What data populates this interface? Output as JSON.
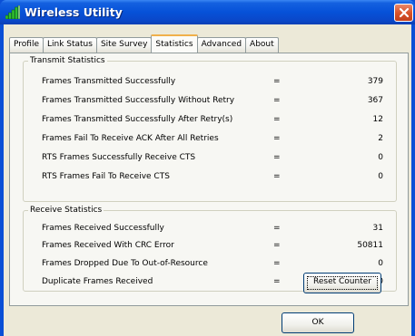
{
  "window": {
    "title": "Wireless Utility",
    "icon": "signal-bars-icon",
    "close_icon": "close-icon",
    "accent_color": "#0a4fd6",
    "close_color": "#d9542b"
  },
  "tabs": [
    {
      "label": "Profile",
      "active": false
    },
    {
      "label": "Link Status",
      "active": false
    },
    {
      "label": "Site Survey",
      "active": false
    },
    {
      "label": "Statistics",
      "active": true
    },
    {
      "label": "Advanced",
      "active": false
    },
    {
      "label": "About",
      "active": false
    }
  ],
  "transmit": {
    "title": "Transmit Statistics",
    "rows": [
      {
        "label": "Frames Transmitted Successfully",
        "eq": "=",
        "value": "379"
      },
      {
        "label": "Frames Transmitted Successfully  Without Retry",
        "eq": "=",
        "value": "367"
      },
      {
        "label": "Frames Transmitted Successfully After Retry(s)",
        "eq": "=",
        "value": "12"
      },
      {
        "label": "Frames Fail To Receive ACK After All Retries",
        "eq": "=",
        "value": "2"
      },
      {
        "label": "RTS Frames Successfully Receive CTS",
        "eq": "=",
        "value": "0"
      },
      {
        "label": "RTS Frames Fail To Receive CTS",
        "eq": "=",
        "value": "0"
      }
    ]
  },
  "receive": {
    "title": "Receive Statistics",
    "rows": [
      {
        "label": "Frames Received Successfully",
        "eq": "=",
        "value": "31"
      },
      {
        "label": "Frames Received With CRC Error",
        "eq": "=",
        "value": "50811"
      },
      {
        "label": "Frames Dropped Due To Out-of-Resource",
        "eq": "=",
        "value": "0"
      },
      {
        "label": "Duplicate Frames Received",
        "eq": "=",
        "value": "0"
      }
    ]
  },
  "buttons": {
    "reset_label": "Reset Counter",
    "ok_label": "OK"
  }
}
